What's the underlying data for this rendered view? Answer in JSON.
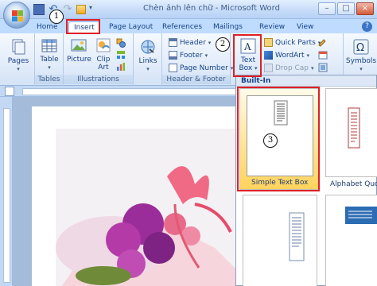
{
  "window": {
    "title": "Chèn ảnh lên chữ - Microsoft Word",
    "minimize_glyph": "–",
    "maximize_glyph": "□",
    "close_glyph": "×"
  },
  "quick_access": {
    "undo_glyph": "↶",
    "redo_glyph": "↷",
    "dropdown_glyph": "▾"
  },
  "tabs": [
    {
      "label": "Home"
    },
    {
      "label": "Insert",
      "active": true
    },
    {
      "label": "Page Layout"
    },
    {
      "label": "References"
    },
    {
      "label": "Mailings"
    },
    {
      "label": "Review"
    },
    {
      "label": "View"
    }
  ],
  "help_glyph": "?",
  "ribbon": {
    "pages": {
      "label": "Pages"
    },
    "tables": {
      "button": "Table",
      "group": "Tables"
    },
    "illustrations": {
      "picture": "Picture",
      "clip_art_line1": "Clip",
      "clip_art_line2": "Art",
      "group": "Illustrations"
    },
    "links": {
      "label": "Links"
    },
    "header_footer": {
      "header": "Header",
      "footer": "Footer",
      "page_number": "Page Number",
      "group": "Header & Footer"
    },
    "text": {
      "text_box_line1": "Text",
      "text_box_line2": "Box",
      "quick_parts": "Quick Parts",
      "wordart": "WordArt",
      "drop_cap": "Drop Cap"
    },
    "symbols": {
      "label": "Symbols"
    }
  },
  "gallery": {
    "header": "Built-In",
    "items": [
      {
        "label": "Simple Text Box"
      },
      {
        "label": "Alphabet Quote"
      }
    ]
  },
  "annotations": [
    "1",
    "2",
    "3"
  ],
  "colors": {
    "ribbon_bg": "#dfe9f5",
    "annotation_red": "#e01f26",
    "selected_gallery_item": "#ffd35c",
    "title_bar": "#c6dcf8"
  }
}
